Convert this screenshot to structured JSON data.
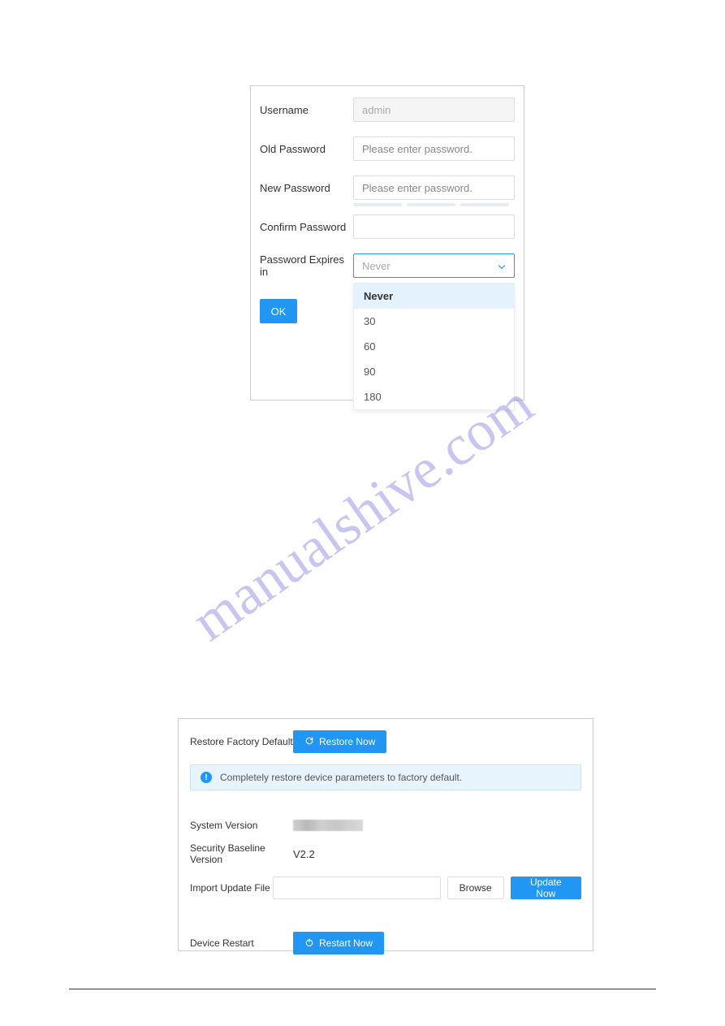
{
  "watermark": "manualshive.com",
  "passwordForm": {
    "usernameLabel": "Username",
    "usernameValue": "admin",
    "oldPasswordLabel": "Old Password",
    "oldPasswordPlaceholder": "Please enter password.",
    "newPasswordLabel": "New Password",
    "newPasswordPlaceholder": "Please enter password.",
    "confirmPasswordLabel": "Confirm Password",
    "expiresLabel": "Password Expires in",
    "expiresSelected": "Never",
    "expiresOptions": [
      "Never",
      "30",
      "60",
      "90",
      "180"
    ],
    "okLabel": "OK"
  },
  "systemPanel": {
    "restoreLabel": "Restore Factory Default",
    "restoreButton": "Restore Now",
    "infoMessage": "Completely restore device parameters to factory default.",
    "systemVersionLabel": "System Version",
    "securityBaselineLabel": "Security Baseline Version",
    "securityBaselineValue": "V2.2",
    "importUpdateLabel": "Import Update File",
    "browseButton": "Browse",
    "updateButton": "Update Now",
    "restartLabel": "Device Restart",
    "restartButton": "Restart Now"
  }
}
